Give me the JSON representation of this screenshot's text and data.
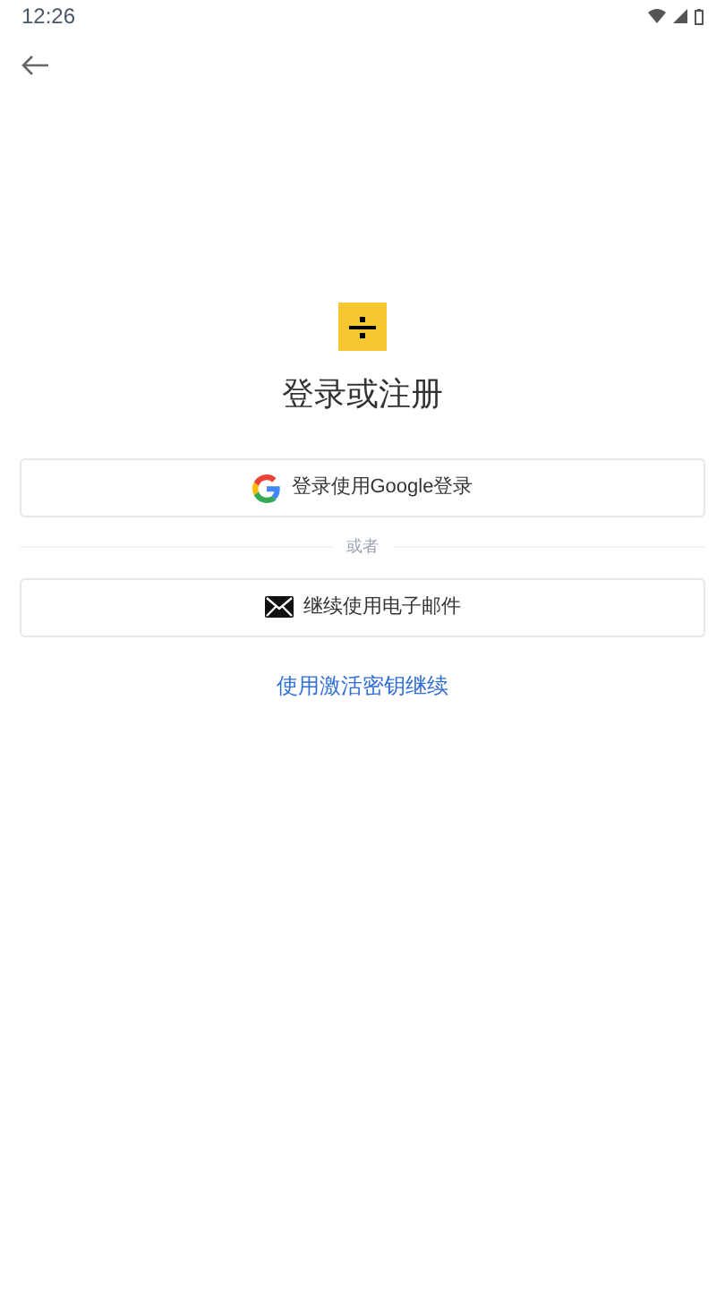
{
  "status_bar": {
    "time": "12:26"
  },
  "title": "登录或注册",
  "buttons": [
    {
      "kind": "google",
      "label": "登录使用Google登录"
    },
    {
      "kind": "email",
      "label": "继续使用电子邮件"
    }
  ],
  "divider": "或者",
  "link": "使用激活密钥继续"
}
